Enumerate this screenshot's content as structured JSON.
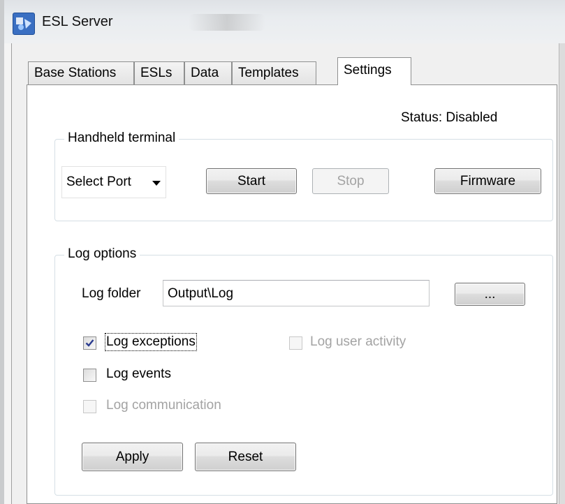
{
  "window": {
    "title": "ESL Server"
  },
  "tabs": [
    "Base Stations",
    "ESLs",
    "Data",
    "Templates",
    "Settings"
  ],
  "active_tab": "Settings",
  "status_text": "Status: Disabled",
  "handheld": {
    "group_label": "Handheld terminal",
    "port_select_value": "Select Port",
    "start_label": "Start",
    "stop_label": "Stop",
    "firmware_label": "Firmware"
  },
  "log": {
    "group_label": "Log options",
    "folder_label": "Log folder",
    "folder_value": "Output\\Log",
    "browse_label": "...",
    "exceptions_label": "Log exceptions",
    "exceptions_checked": true,
    "user_activity_label": "Log user activity",
    "events_label": "Log events",
    "communication_label": "Log communication",
    "apply_label": "Apply",
    "reset_label": "Reset"
  },
  "icons": {
    "app": "esl-server-icon",
    "check": "checkmark-icon",
    "dropdown": "chevron-down-icon"
  }
}
